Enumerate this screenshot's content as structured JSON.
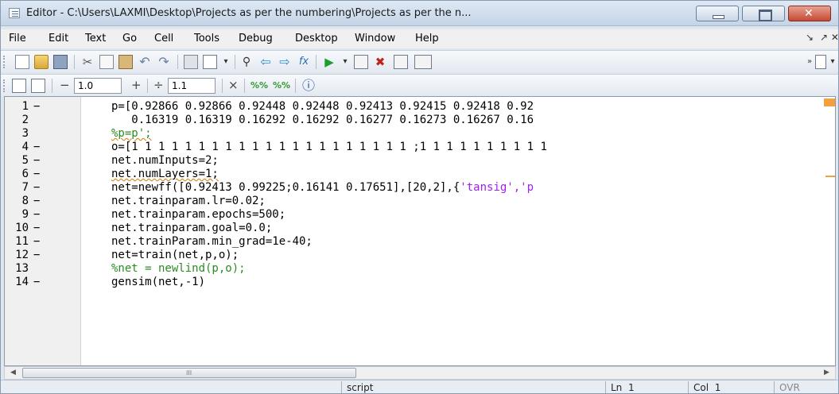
{
  "window": {
    "title": "Editor - C:\\Users\\LAXMI\\Desktop\\Projects as per the numbering\\Projects as per the n..."
  },
  "menu": {
    "items": [
      "File",
      "Edit",
      "Text",
      "Go",
      "Cell",
      "Tools",
      "Debug",
      "Desktop",
      "Window",
      "Help"
    ],
    "right_glyphs": [
      "↘",
      "↗ ✕"
    ]
  },
  "cell_toolbar": {
    "minus": "−",
    "value1": "1.0",
    "plus": "+",
    "divide": "÷",
    "value2": "1.1",
    "times": "×"
  },
  "editor": {
    "lines": [
      {
        "num": "1",
        "dash": "−",
        "code": "p=[0.92866 0.92866 0.92448 0.92448 0.92413 0.92415 0.92418 0.92",
        "kind": "code"
      },
      {
        "num": "2",
        "dash": "",
        "code": "   0.16319 0.16319 0.16292 0.16292 0.16277 0.16273 0.16267 0.16",
        "kind": "code"
      },
      {
        "num": "3",
        "dash": "",
        "code": "%p=p';",
        "kind": "comment"
      },
      {
        "num": "4",
        "dash": "−",
        "code": "o=[1 1 1 1 1 1 1 1 1 1 1 1 1 1 1 1 1 1 1 1 1 ;1 1 1 1 1 1 1 1 1 1",
        "kind": "code"
      },
      {
        "num": "5",
        "dash": "−",
        "code": "net.numInputs=2;",
        "kind": "code"
      },
      {
        "num": "6",
        "dash": "−",
        "code": "net.numLayers=1;",
        "kind": "code"
      },
      {
        "num": "7",
        "dash": "−",
        "code": "net=newff([0.92413 0.99225;0.16141 0.17651],[20,2],{",
        "str": "'tansig','p",
        "kind": "code"
      },
      {
        "num": "8",
        "dash": "−",
        "code": "net.trainparam.lr=0.02;",
        "kind": "code"
      },
      {
        "num": "9",
        "dash": "−",
        "code": "net.trainparam.epochs=500;",
        "kind": "code"
      },
      {
        "num": "10",
        "dash": "−",
        "code": "net.trainparam.goal=0.0;",
        "kind": "code"
      },
      {
        "num": "11",
        "dash": "−",
        "code": "net.trainParam.min_grad=1e-40;",
        "kind": "code"
      },
      {
        "num": "12",
        "dash": "−",
        "code": "net=train(net,p,o);",
        "kind": "code"
      },
      {
        "num": "13",
        "dash": "",
        "code": "%net = newlind(p,o);",
        "kind": "comment"
      },
      {
        "num": "14",
        "dash": "−",
        "code": "gensim(net,-1)",
        "kind": "code"
      }
    ]
  },
  "scrollbar": {
    "left_arrow": "◀",
    "right_arrow": "▶",
    "grip": "III"
  },
  "status": {
    "mode": "script",
    "ln_label": "Ln",
    "ln_value": "1",
    "col_label": "Col",
    "col_value": "1",
    "ovr": "OVR"
  }
}
